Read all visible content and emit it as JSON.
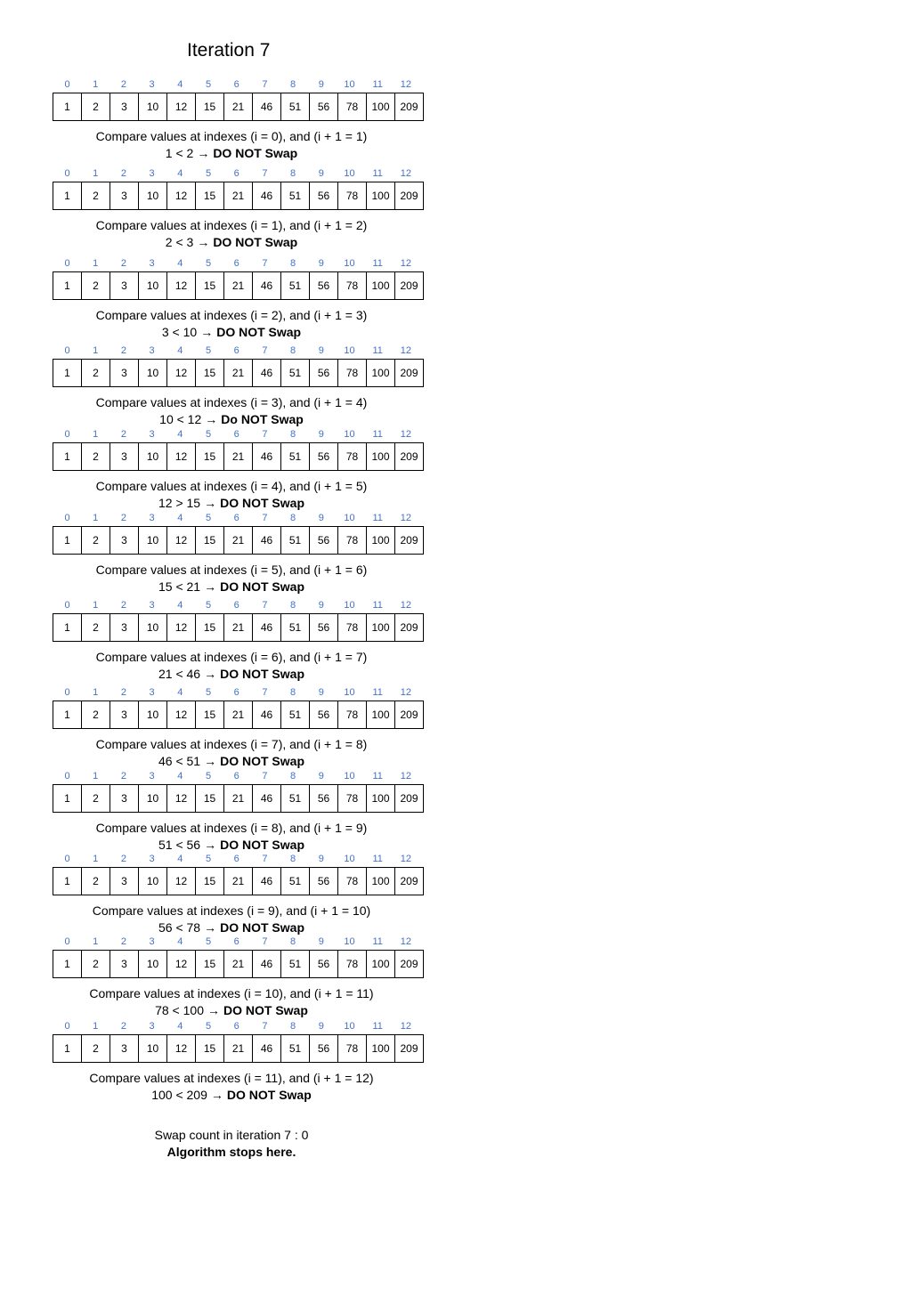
{
  "title": "Iteration 7",
  "indexes": [
    "0",
    "1",
    "2",
    "3",
    "4",
    "5",
    "6",
    "7",
    "8",
    "9",
    "10",
    "11",
    "12"
  ],
  "array": [
    "1",
    "2",
    "3",
    "10",
    "12",
    "15",
    "21",
    "46",
    "51",
    "56",
    "78",
    "100",
    "209"
  ],
  "steps": [
    {
      "compare": "Compare values at indexes (i = 0), and (i + 1 = 1)",
      "relation": "1 < 2",
      "result": "DO NOT Swap"
    },
    {
      "compare": "Compare values at indexes (i = 1), and (i + 1 = 2)",
      "relation": "2 < 3",
      "result": "DO NOT Swap"
    },
    {
      "compare": "Compare values at indexes (i = 2), and (i + 1 = 3)",
      "relation": "3 < 10",
      "result": "DO NOT Swap"
    },
    {
      "compare": "Compare values at indexes (i = 3), and (i + 1 = 4)",
      "relation": "10 < 12",
      "result": "Do NOT Swap"
    },
    {
      "compare": "Compare values at indexes (i = 4), and (i + 1 = 5)",
      "relation": "12 > 15",
      "result": "DO NOT Swap"
    },
    {
      "compare": "Compare values at indexes (i = 5), and (i + 1 = 6)",
      "relation": "15 < 21",
      "result": "DO NOT Swap"
    },
    {
      "compare": "Compare values at indexes (i = 6), and (i + 1 = 7)",
      "relation": "21 < 46",
      "result": "DO NOT Swap"
    },
    {
      "compare": "Compare values at indexes (i = 7), and (i + 1 = 8)",
      "relation": "46 < 51",
      "result": "DO NOT Swap"
    },
    {
      "compare": "Compare values at indexes (i = 8), and (i + 1 = 9)",
      "relation": "51 < 56",
      "result": "DO NOT Swap"
    },
    {
      "compare": "Compare values at indexes (i = 9), and (i + 1 = 10)",
      "relation": "56 < 78",
      "result": "DO NOT Swap"
    },
    {
      "compare": "Compare values at indexes (i = 10), and (i + 1 = 11)",
      "relation": "78 < 100",
      "result": "DO NOT Swap"
    },
    {
      "compare": "Compare values at indexes (i = 11), and (i + 1 = 12)",
      "relation": "100 < 209",
      "result": "DO NOT Swap"
    }
  ],
  "summary": {
    "swap_count": "Swap count in iteration 7 : 0",
    "stop": "Algorithm stops here."
  },
  "arrow_icon": "right-arrow-icon",
  "index_color": "#4472c4"
}
